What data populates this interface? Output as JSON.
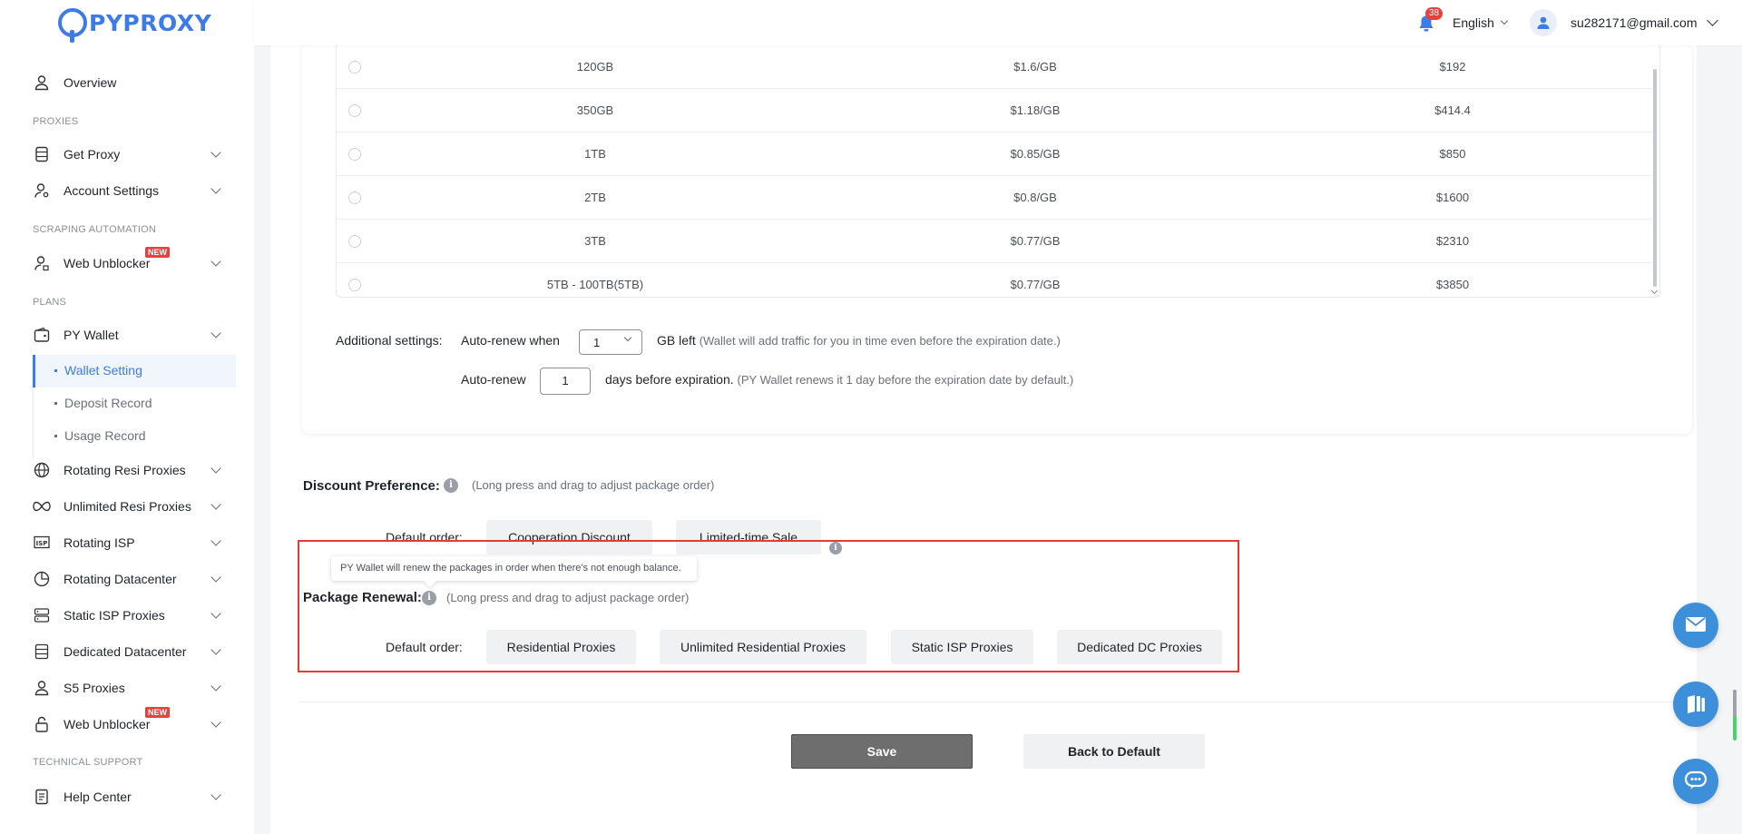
{
  "brand": {
    "name": "PYPROXY"
  },
  "topbar": {
    "notification_count": "38",
    "language": "English",
    "user_email": "su282171@gmail.com"
  },
  "sidebar": {
    "overview": "Overview",
    "section_proxies": "PROXIES",
    "get_proxy": "Get Proxy",
    "account_settings": "Account Settings",
    "section_scraping": "SCRAPING AUTOMATION",
    "web_unblocker_1": "Web Unblocker",
    "new_badge": "NEW",
    "section_plans": "PLANS",
    "py_wallet": "PY Wallet",
    "wallet_setting": "Wallet Setting",
    "deposit_record": "Deposit Record",
    "usage_record": "Usage Record",
    "rotating_resi": "Rotating Resi Proxies",
    "unlimited_resi": "Unlimited Resi Proxies",
    "rotating_isp": "Rotating ISP",
    "rotating_dc": "Rotating Datacenter",
    "static_isp": "Static ISP Proxies",
    "dedicated_dc": "Dedicated Datacenter",
    "s5_proxies": "S5 Proxies",
    "web_unblocker_2": "Web Unblocker",
    "section_support": "TECHNICAL SUPPORT",
    "help_center": "Help Center"
  },
  "packages": [
    {
      "size": "120GB",
      "price_per_gb": "$1.6/GB",
      "total": "$192"
    },
    {
      "size": "350GB",
      "price_per_gb": "$1.18/GB",
      "total": "$414.4"
    },
    {
      "size": "1TB",
      "price_per_gb": "$0.85/GB",
      "total": "$850"
    },
    {
      "size": "2TB",
      "price_per_gb": "$0.8/GB",
      "total": "$1600"
    },
    {
      "size": "3TB",
      "price_per_gb": "$0.77/GB",
      "total": "$2310"
    },
    {
      "size": "5TB - 100TB(5TB)",
      "price_per_gb": "$0.77/GB",
      "total": "$3850"
    }
  ],
  "additional": {
    "label": "Additional settings:",
    "auto_renew_when": "Auto-renew when",
    "gb_select_value": "1",
    "gb_left": "GB left",
    "gb_hint": "(Wallet will add traffic for you in time even before the expiration date.)",
    "auto_renew": "Auto-renew",
    "days_value": "1",
    "days_before": "days before expiration.",
    "days_hint": "(PY Wallet renews it 1 day before the expiration date by default.)"
  },
  "discount": {
    "title": "Discount Preference:",
    "hint": "(Long press and drag to adjust package order)",
    "order_label": "Default order:",
    "chips": [
      "Cooperation Discount",
      "Limited-time Sale"
    ]
  },
  "renewal": {
    "tooltip": "PY Wallet will renew the packages in order when there's not enough balance.",
    "title": "Package Renewal:",
    "hint": "(Long press and drag to adjust package order)",
    "order_label": "Default order:",
    "chips": [
      "Residential Proxies",
      "Unlimited Residential Proxies",
      "Static ISP Proxies",
      "Dedicated DC Proxies"
    ]
  },
  "actions": {
    "save": "Save",
    "back_to_default": "Back to Default"
  },
  "colors": {
    "accent": "#3d7be8",
    "badge_red": "#e8403a",
    "highlight_red": "#e63a35",
    "float_blue": "#3d8fd9"
  }
}
